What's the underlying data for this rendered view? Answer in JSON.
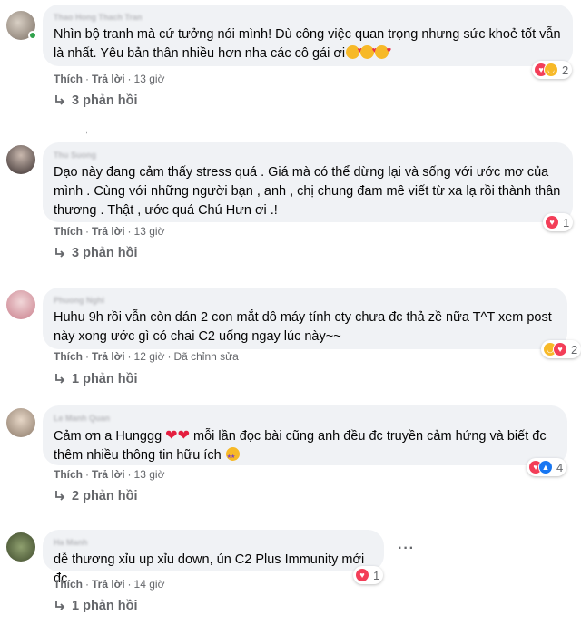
{
  "comments": [
    {
      "author": "Thao Hong Thach Tran",
      "text": "Nhìn bộ tranh mà cứ tưởng nói mình! Dù công việc quan trọng nhưng sức khoẻ tốt vẫn là nhất. Yêu bản thân nhiều hơn nha các cô gái ơi",
      "like": "Thích",
      "reply": "Trả lời",
      "time": "13 giờ",
      "edited": "",
      "reaction_count": "2",
      "reaction_icons": [
        "love-reaction-icon",
        "haha-reaction-icon"
      ],
      "replies": "3 phản hồi"
    },
    {
      "author": "Thu Suong",
      "text": "Dạo này đang cảm thấy stress quá . Giá mà có thể dừng lại và sống với ước mơ của mình . Cùng với những người bạn , anh , chị chung đam mê viết từ xa lạ rồi thành thân thương . Thật , ước quá Chú Hưn ơi .!",
      "like": "Thích",
      "reply": "Trả lời",
      "time": "13 giờ",
      "edited": "",
      "reaction_count": "1",
      "reaction_icons": [
        "love-reaction-icon"
      ],
      "replies": "3 phản hồi"
    },
    {
      "author": "Phuong Nghi",
      "text": "Huhu 9h rồi vẫn còn dán 2 con mắt dô máy tính cty chưa đc thả zề nữa T^T xem post này xong ước gì có chai C2 uống ngay lúc này~~",
      "like": "Thích",
      "reply": "Trả lời",
      "time": "12 giờ",
      "edited": "Đã chỉnh sửa",
      "reaction_count": "2",
      "reaction_icons": [
        "haha-reaction-icon",
        "love-reaction-icon"
      ],
      "replies": "1 phản hồi"
    },
    {
      "author": "Le Manh Quan",
      "text_before": "Cảm ơn a Hunggg",
      "text_after": " mỗi lần đọc bài cũng anh đều đc truyền cảm hứng và biết đc thêm nhiều thông tin hữu ích",
      "like": "Thích",
      "reply": "Trả lời",
      "time": "13 giờ",
      "edited": "",
      "reaction_count": "4",
      "reaction_icons": [
        "love-reaction-icon",
        "like-reaction-icon"
      ],
      "replies": "2 phản hồi"
    },
    {
      "author": "Ha Manh",
      "text": "dễ thương xỉu up xỉu down, ún C2 Plus Immunity mới đc",
      "like": "Thích",
      "reply": "Trả lời",
      "time": "14 giờ",
      "edited": "",
      "reaction_count": "1",
      "reaction_icons": [
        "love-reaction-icon"
      ],
      "replies": "1 phản hồi"
    }
  ],
  "stray_mark": ",",
  "more_glyph": "···",
  "colors": {
    "bubble": "#f0f2f5",
    "secondary_text": "#65676b",
    "love": "#f33e58",
    "haha": "#f7b928",
    "like": "#1877f2",
    "online": "#31a24c"
  }
}
